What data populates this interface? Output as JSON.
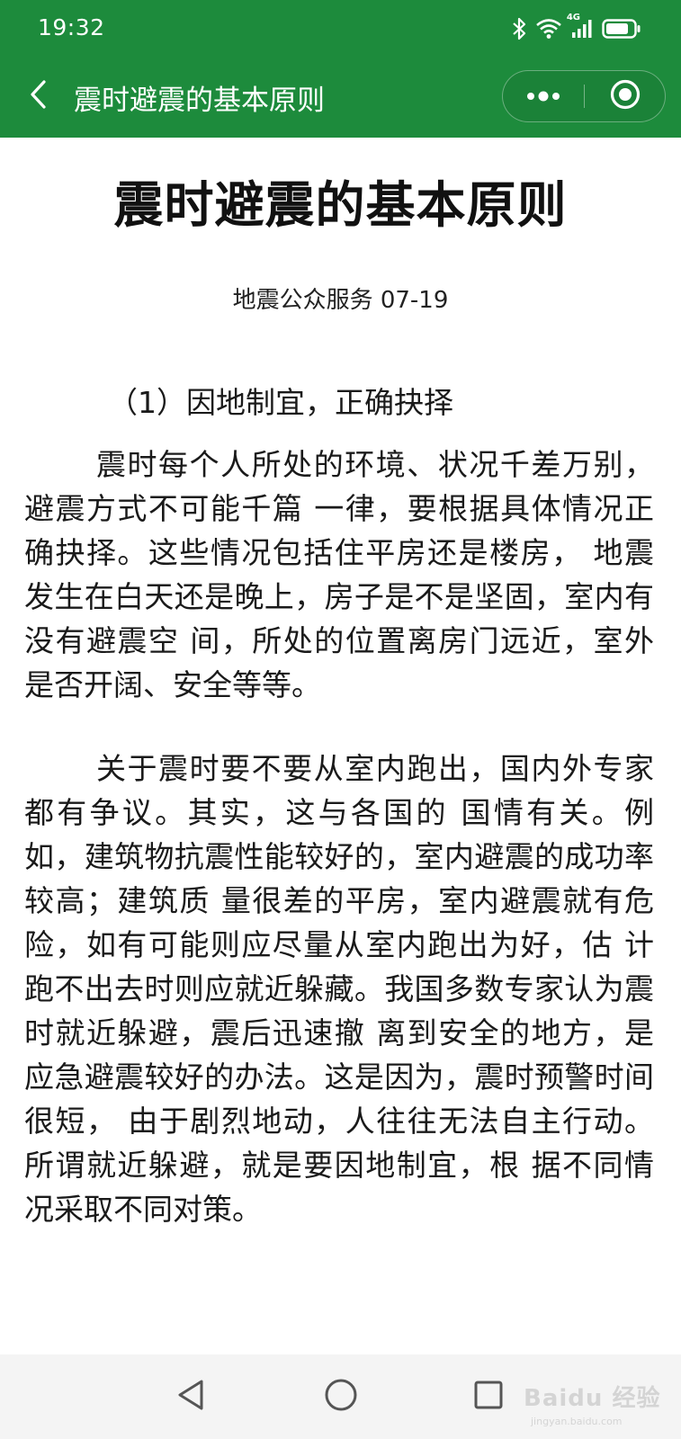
{
  "status_bar": {
    "time": "19:32",
    "network_label": "4G",
    "icons": [
      "bluetooth-icon",
      "wifi-icon",
      "cellular-signal-icon",
      "battery-icon"
    ]
  },
  "header": {
    "title": "震时避震的基本原则",
    "icons": [
      "back-chevron-icon",
      "more-dots-icon",
      "close-target-icon"
    ]
  },
  "article": {
    "title": "震时避震的基本原则",
    "meta": "地震公众服务 07-19",
    "section_heading": "（1）因地制宜，正确抉择",
    "paragraphs": [
      "震时每个人所处的环境、状况千差万别，避震方式不可能千篇 一律，要根据具体情况正确抉择。这些情况包括住平房还是楼房， 地震发生在白天还是晚上，房子是不是坚固，室内有没有避震空 间，所处的位置离房门远近，室外是否开阔、安全等等。",
      "关于震时要不要从室内跑出，国内外专家都有争议。其实，这与各国的 国情有关。例如，建筑物抗震性能较好的，室内避震的成功率较高；建筑质 量很差的平房，室内避震就有危险，如有可能则应尽量从室内跑出为好，估 计跑不出去时则应就近躲藏。我国多数专家认为震时就近躲避，震后迅速撤 离到安全的地方，是应急避震较好的办法。这是因为，震时预警时间很短， 由于剧烈地动，人往往无法自主行动。所谓就近躲避，就是要因地制宜，根 据不同情况采取不同对策。"
    ]
  },
  "nav_bar": {
    "icons": [
      "back-triangle-icon",
      "home-circle-icon",
      "recents-square-icon"
    ]
  },
  "watermark": {
    "logo": "Baidu 经验",
    "url": "jingyan.baidu.com"
  },
  "colors": {
    "header_green": "#1d8b3c",
    "nav_background": "#f4f4f4",
    "text": "#1a1a1a"
  }
}
